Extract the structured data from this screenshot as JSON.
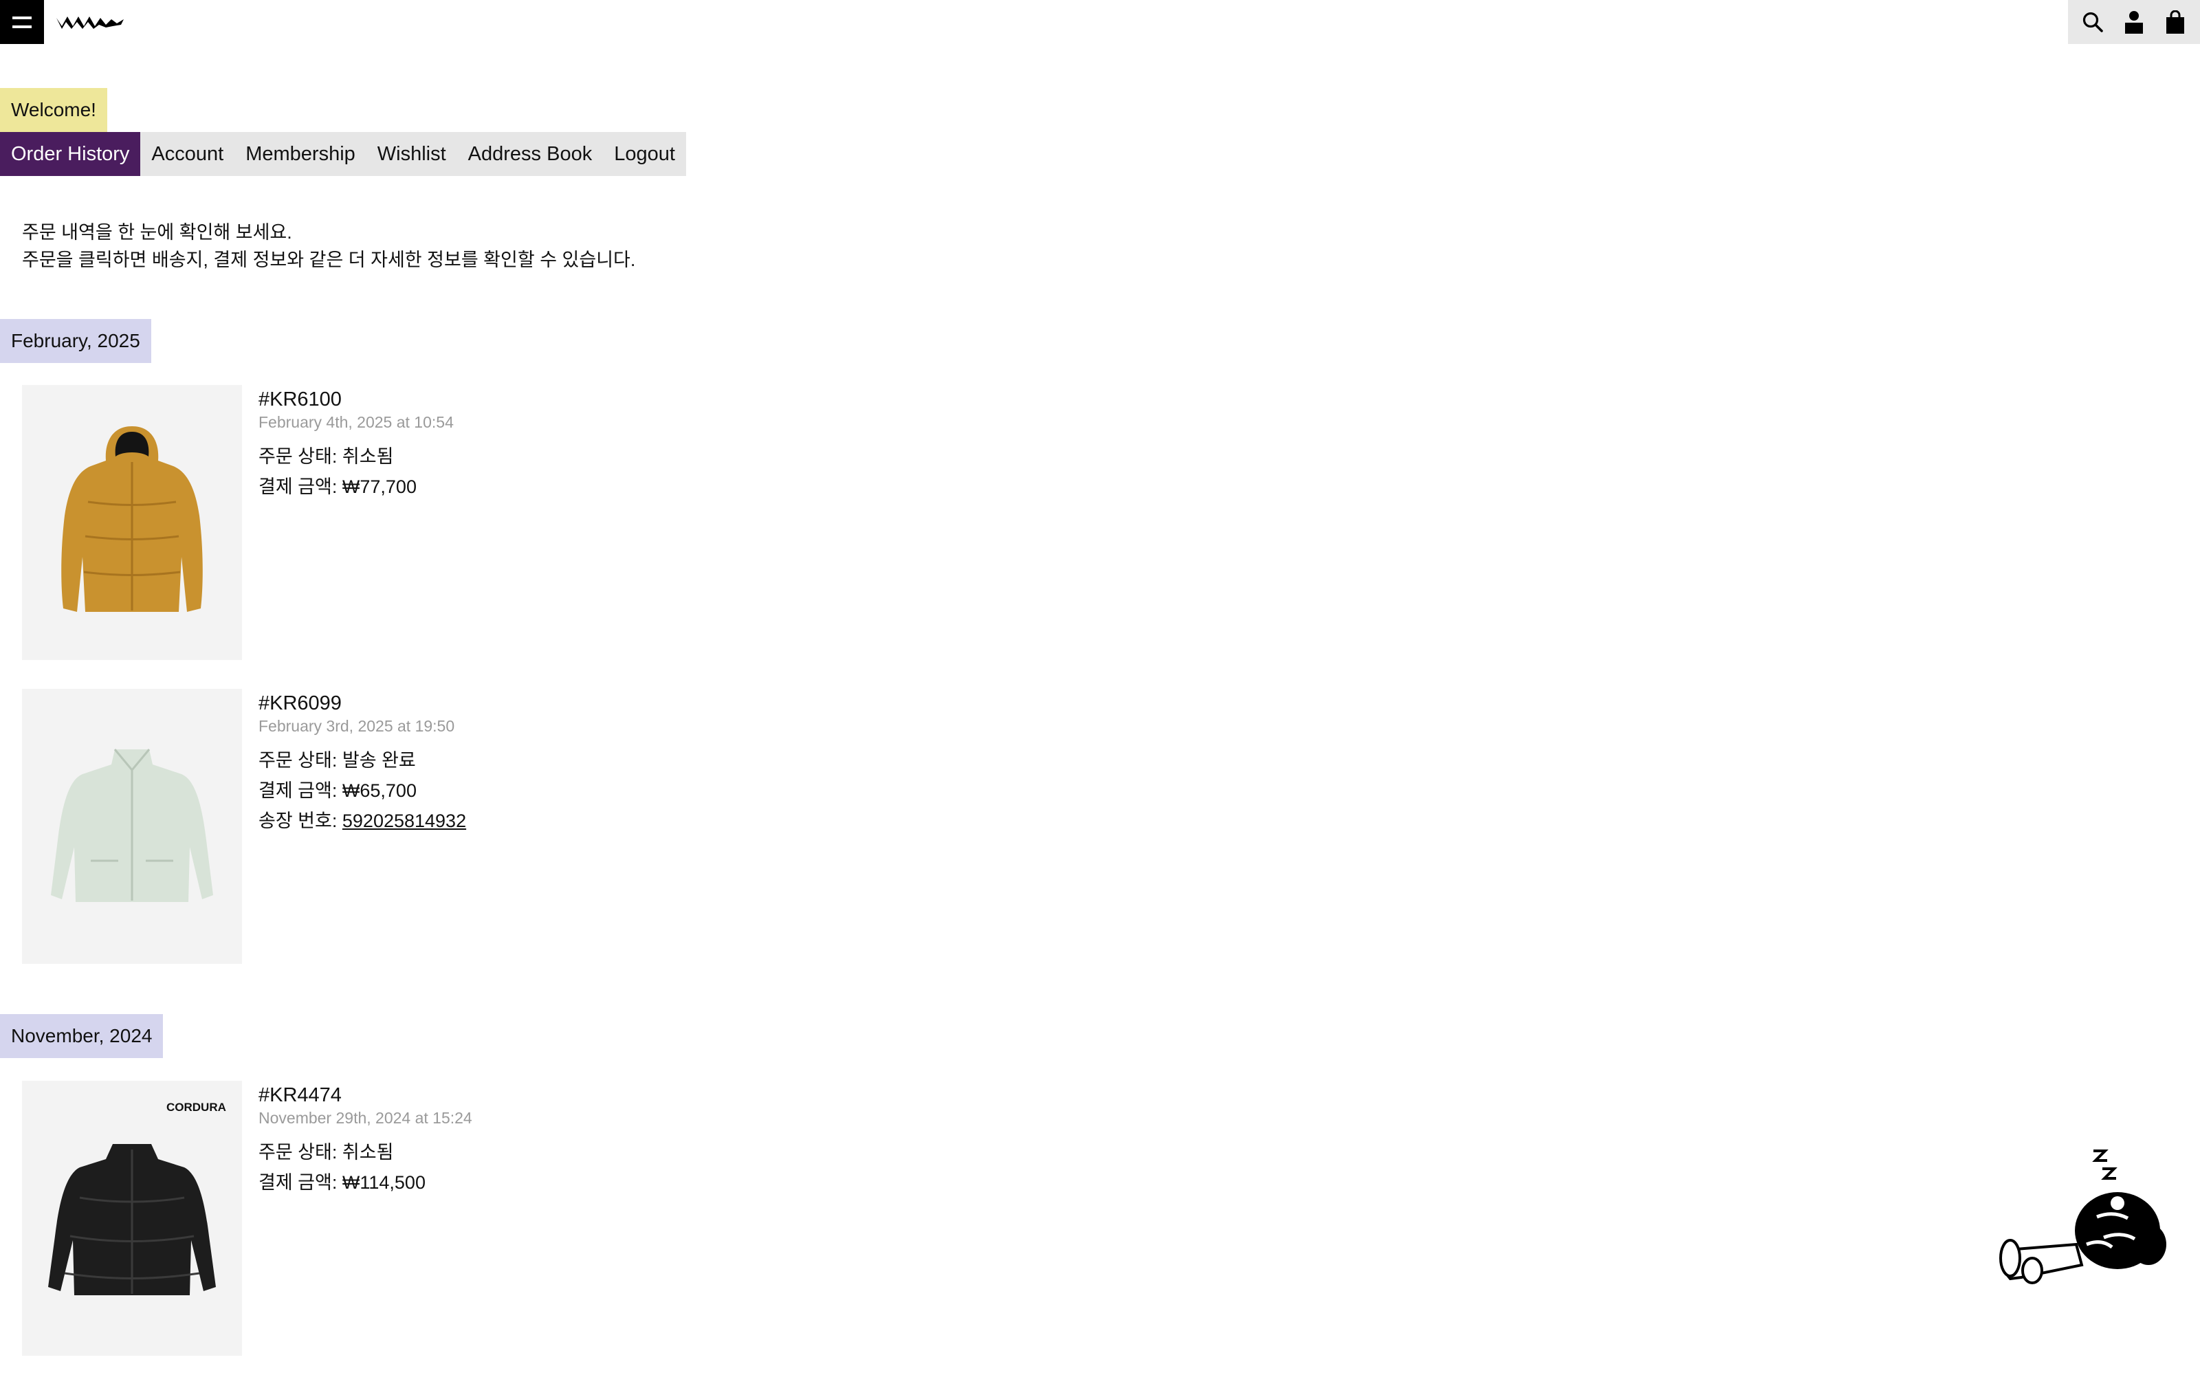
{
  "header": {
    "menu_icon": "hamburger-icon",
    "logo_icon": "brand-logo",
    "icons": [
      "search-icon",
      "account-icon",
      "bag-icon"
    ]
  },
  "welcome": "Welcome!",
  "tabs": [
    {
      "label": "Order History",
      "active": true
    },
    {
      "label": "Account",
      "active": false
    },
    {
      "label": "Membership",
      "active": false
    },
    {
      "label": "Wishlist",
      "active": false
    },
    {
      "label": "Address Book",
      "active": false
    },
    {
      "label": "Logout",
      "active": false
    }
  ],
  "intro": {
    "line1": "주문 내역을 한 눈에 확인해 보세요.",
    "line2": "주문을 클릭하면 배송지, 결제 정보와 같은 더 자세한 정보를 확인할 수 있습니다."
  },
  "groups": [
    {
      "month": "February, 2025",
      "orders": [
        {
          "id": "#KR6100",
          "date": "February 4th, 2025 at 10:54",
          "status_label": "주문 상태:",
          "status": "취소됨",
          "amount_label": "결제 금액:",
          "amount": "₩77,700",
          "product_image": "mustard-puffer-jacket"
        },
        {
          "id": "#KR6099",
          "date": "February 3rd, 2025 at 19:50",
          "status_label": "주문 상태:",
          "status": "발송 완료",
          "amount_label": "결제 금액:",
          "amount": "₩65,700",
          "tracking_label": "송장 번호:",
          "tracking": "592025814932",
          "product_image": "mint-fleece-jacket"
        }
      ]
    },
    {
      "month": "November, 2024",
      "orders": [
        {
          "id": "#KR4474",
          "date": "November 29th, 2024 at 15:24",
          "status_label": "주문 상태:",
          "status": "취소됨",
          "amount_label": "결제 금액:",
          "amount": "₩114,500",
          "product_image": "black-puffer-jacket",
          "badge_text": "CORDURA"
        }
      ]
    }
  ],
  "colors": {
    "welcome_bg": "#eee79a",
    "active_tab_bg": "#4a1d5e",
    "tabs_bg": "#e6e6e6",
    "month_bg": "#d5d5ee"
  }
}
